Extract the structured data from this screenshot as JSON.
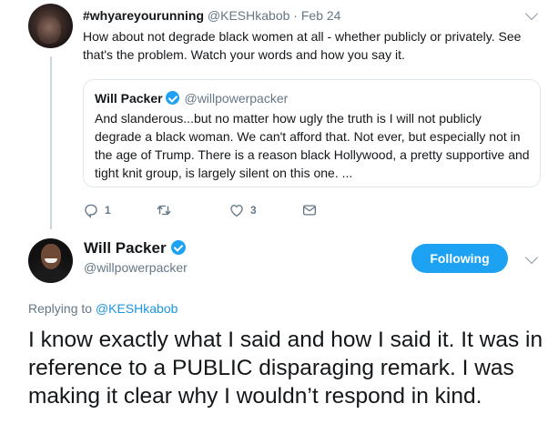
{
  "parent_tweet": {
    "display_name": "#whyareyourunning",
    "handle": "@KESHkabob",
    "separator": "·",
    "timestamp": "Feb 24",
    "text": "How about not degrade black women at all - whether publicly or privately. See that's the problem. Watch your words and how you say it.",
    "quoted_tweet": {
      "display_name": "Will Packer",
      "handle": "@willpowerpacker",
      "verified": true,
      "text": "And slanderous...but no matter how ugly the truth is I will not publicly degrade a black woman. We can't afford that. Not ever, but especially not in the age of Trump. There is a reason black Hollywood, a pretty supportive and tight knit group, is largely silent on this one. ..."
    },
    "actions": {
      "reply_count": "1",
      "retweet_count": "",
      "like_count": "3"
    }
  },
  "main_tweet": {
    "display_name": "Will Packer",
    "handle": "@willpowerpacker",
    "verified": true,
    "follow_button_label": "Following",
    "replying_prefix": "Replying to",
    "replying_to": "@KESHkabob",
    "text": "I know exactly what I said and how I said it. It was in reference to a PUBLIC disparaging remark. I was making it clear why I wouldn’t respond in kind."
  },
  "colors": {
    "accent": "#1da1f2",
    "link": "#1b95e0",
    "muted": "#657786",
    "text": "#14171a",
    "border": "#e1e8ed"
  },
  "icons": {
    "reply": "reply-icon",
    "retweet": "retweet-icon",
    "like": "heart-icon",
    "message": "envelope-icon",
    "verified": "verified-badge-icon",
    "menu": "chevron-down-icon"
  }
}
